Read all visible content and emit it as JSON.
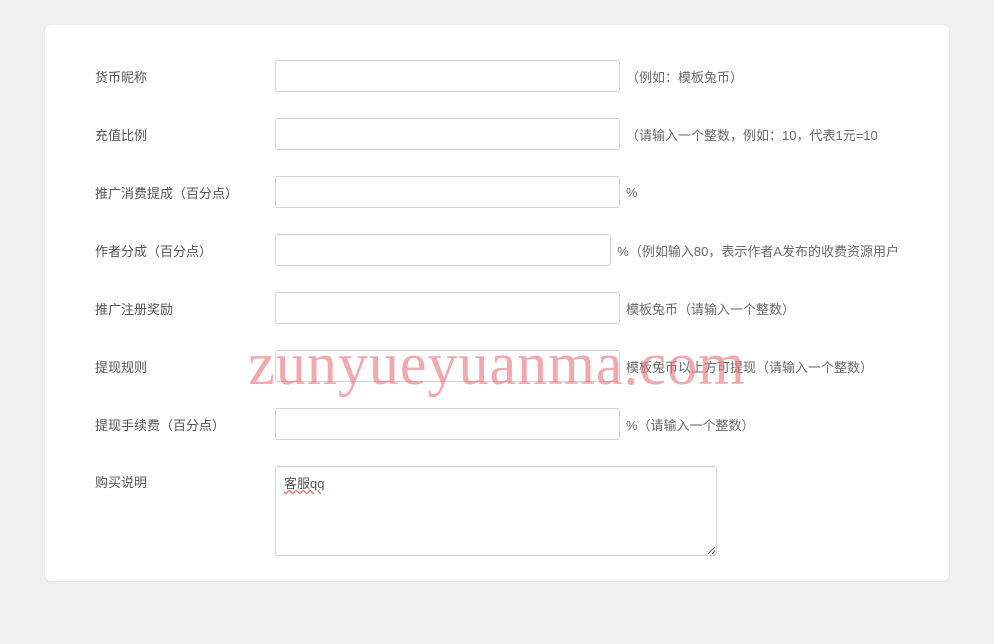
{
  "watermark": "zunyueyuanma.com",
  "fields": {
    "currency_nickname": {
      "label": "货币昵称",
      "value": "",
      "hint": "（例如：模板兔币）"
    },
    "recharge_ratio": {
      "label": "充值比例",
      "value": "",
      "hint": "（请输入一个整数，例如：10，代表1元=10"
    },
    "promotion_commission": {
      "label": "推广消费提成（百分点）",
      "value": "",
      "hint": "%"
    },
    "author_share": {
      "label": "作者分成（百分点）",
      "value": "",
      "hint": "%（例如输入80，表示作者A发布的收费资源用户"
    },
    "promotion_register_reward": {
      "label": "推广注册奖励",
      "value": "",
      "hint": "模板兔币（请输入一个整数）"
    },
    "withdraw_rule": {
      "label": "提现规则",
      "value": "",
      "hint": "模板兔币以上方可提现（请输入一个整数）"
    },
    "withdraw_fee": {
      "label": "提现手续费（百分点）",
      "value": "",
      "hint": "%（请输入一个整数）"
    },
    "purchase_note": {
      "label": "购买说明",
      "value": "客服qq"
    }
  }
}
